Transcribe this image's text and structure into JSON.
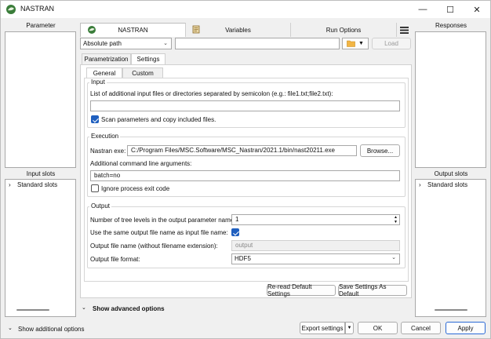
{
  "window": {
    "title": "NASTRAN",
    "minimize": "—",
    "maximize": "☐",
    "close": "✕"
  },
  "left": {
    "parameter_label": "Parameter",
    "input_slots_label": "Input slots",
    "input_tree_item": "Standard slots"
  },
  "right": {
    "responses_label": "Responses",
    "output_slots_label": "Output slots",
    "output_tree_item": "Standard slots"
  },
  "tabs": [
    {
      "label": "NASTRAN",
      "active": true
    },
    {
      "label": "Variables",
      "active": false
    },
    {
      "label": "Run Options",
      "active": false
    }
  ],
  "path_mode": {
    "value": "Absolute path"
  },
  "path_input": {
    "value": ""
  },
  "load_button": "Load",
  "subtabs": [
    {
      "label": "Parametrization"
    },
    {
      "label": "Settings"
    }
  ],
  "subsubtabs": [
    {
      "label": "General"
    },
    {
      "label": "Custom"
    }
  ],
  "input_group": {
    "title": "Input",
    "files_label": "List of additional input files or directories separated by semicolon (e.g.: file1.txt;file2.txt):",
    "files_value": "",
    "scan_label": "Scan parameters and copy included files.",
    "scan_checked": true
  },
  "execution_group": {
    "title": "Execution",
    "exe_label": "Nastran exe:",
    "exe_value": "C:/Program Files/MSC.Software/MSC_Nastran/2021.1/bin/nast20211.exe",
    "browse_label": "Browse...",
    "args_label": "Additional command line arguments:",
    "args_value": "batch=no",
    "ignore_label": "Ignore process exit code",
    "ignore_checked": false
  },
  "output_group": {
    "title": "Output",
    "levels_label": "Number of tree levels in the output parameter name:",
    "levels_value": "1",
    "same_name_label": "Use the same output file name as input file name:",
    "same_name_checked": true,
    "name_label": "Output file name (without filename extension):",
    "name_placeholder": "output",
    "format_label": "Output file format:",
    "format_value": "HDF5"
  },
  "actions": {
    "reread": "Re-read Default Settings",
    "save_default": "Save Settings As Default"
  },
  "advanced": {
    "label": "Show advanced options"
  },
  "footer": {
    "additional": "Show additional options",
    "export": "Export settings",
    "ok": "OK",
    "cancel": "Cancel",
    "apply": "Apply"
  },
  "colors": {
    "accent": "#1f5fbf",
    "primary_border": "#2b6ad6"
  }
}
